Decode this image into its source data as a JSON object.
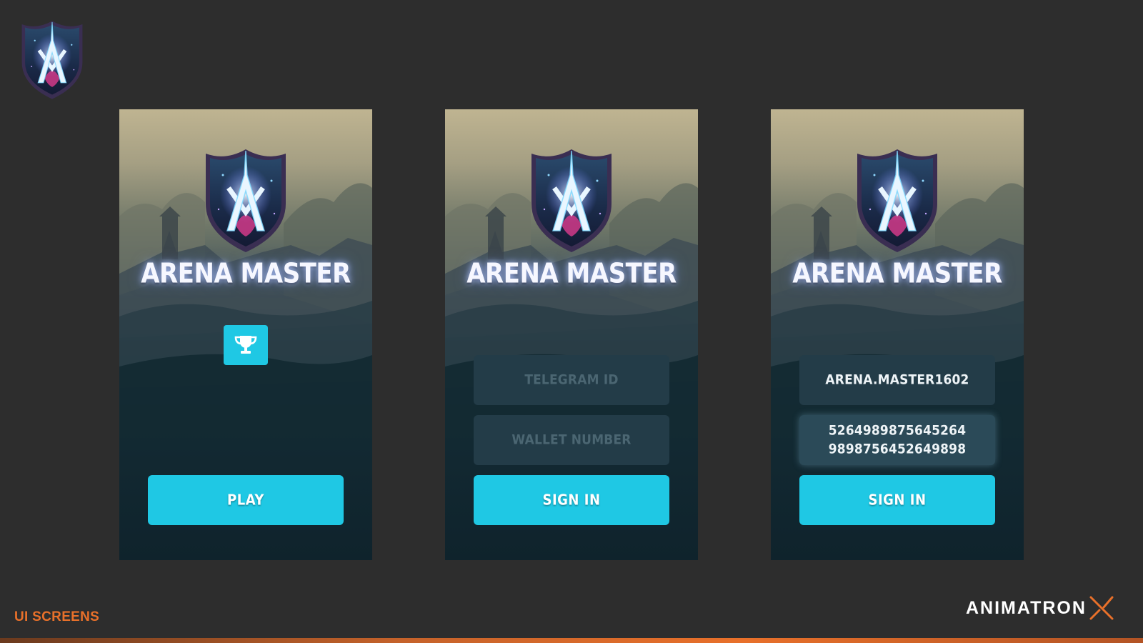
{
  "app": {
    "title": "ARENA MASTER"
  },
  "screens": [
    {
      "title": "ARENA MASTER",
      "trophy_icon": "trophy-icon",
      "primary_button": "PLAY"
    },
    {
      "title": "ARENA MASTER",
      "fields": [
        {
          "value": "",
          "placeholder": "TELEGRAM ID"
        },
        {
          "value": "",
          "placeholder": "WALLET NUMBER"
        }
      ],
      "primary_button": "SIGN IN"
    },
    {
      "title": "ARENA MASTER",
      "fields": [
        {
          "value": "ARENA.MASTER1602",
          "placeholder": "TELEGRAM ID"
        },
        {
          "value_line1": "5264989875645264",
          "value_line2": "9898756452649898",
          "placeholder": "WALLET NUMBER"
        }
      ],
      "primary_button": "SIGN IN"
    }
  ],
  "footer": {
    "caption": "UI SCREENS",
    "brand": "ANIMATRON"
  },
  "colors": {
    "background": "#2d2d2d",
    "accent_cyan": "#1fc8e4",
    "field_bg": "#233c48",
    "placeholder": "#4b6672",
    "caption_orange": "#e8702a"
  }
}
